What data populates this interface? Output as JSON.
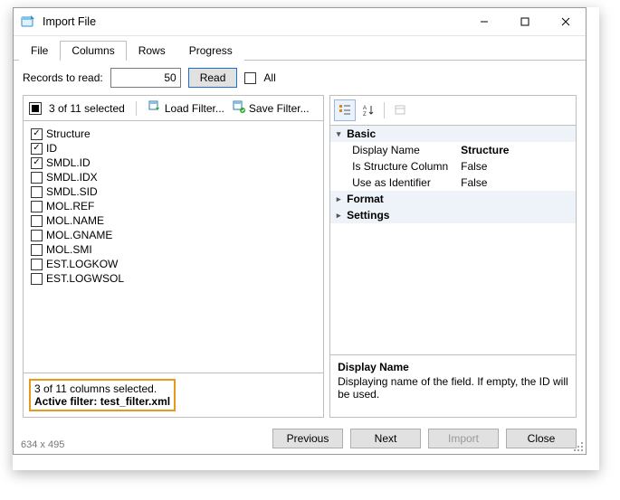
{
  "window": {
    "title": "Import File"
  },
  "tabs": {
    "items": [
      "File",
      "Columns",
      "Rows",
      "Progress"
    ],
    "active_index": 1
  },
  "records": {
    "label": "Records to read:",
    "value": "50",
    "read_label": "Read",
    "all_label": "All",
    "all_checked": false
  },
  "left": {
    "selection_summary": "3 of 11 selected",
    "load_filter_label": "Load Filter...",
    "save_filter_label": "Save Filter...",
    "columns": [
      {
        "name": "Structure",
        "checked": true
      },
      {
        "name": "ID",
        "checked": true
      },
      {
        "name": "SMDL.ID",
        "checked": true
      },
      {
        "name": "SMDL.IDX",
        "checked": false
      },
      {
        "name": "SMDL.SID",
        "checked": false
      },
      {
        "name": "MOL.REF",
        "checked": false
      },
      {
        "name": "MOL.NAME",
        "checked": false
      },
      {
        "name": "MOL.GNAME",
        "checked": false
      },
      {
        "name": "MOL.SMI",
        "checked": false
      },
      {
        "name": "EST.LOGKOW",
        "checked": false
      },
      {
        "name": "EST.LOGWSOL",
        "checked": false
      }
    ],
    "status_line1": "3 of 11 columns selected.",
    "status_line2_label": "Active filter:",
    "status_line2_value": "test_filter.xml"
  },
  "right": {
    "categories": [
      {
        "name": "Basic",
        "expanded": true,
        "rows": [
          {
            "key": "Display Name",
            "value": "Structure",
            "bold": true
          },
          {
            "key": "Is Structure Column",
            "value": "False"
          },
          {
            "key": "Use as Identifier",
            "value": "False"
          }
        ]
      },
      {
        "name": "Format",
        "expanded": false,
        "rows": []
      },
      {
        "name": "Settings",
        "expanded": false,
        "rows": []
      }
    ],
    "desc_title": "Display Name",
    "desc_body": "Displaying name of the field. If empty, the ID will be used."
  },
  "footer": {
    "previous": "Previous",
    "next": "Next",
    "import": "Import",
    "close": "Close"
  },
  "dimensions_label": "634 x 495"
}
